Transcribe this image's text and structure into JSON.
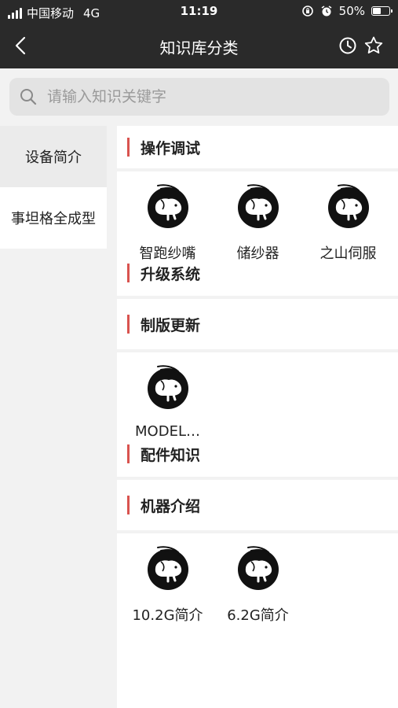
{
  "status_bar": {
    "carrier": "中国移动",
    "network": "4G",
    "time": "11:19",
    "battery_text": "50%",
    "battery_level": 0.5
  },
  "nav": {
    "title": "知识库分类"
  },
  "search": {
    "placeholder": "请输入知识关键字",
    "value": ""
  },
  "sidebar": {
    "items": [
      {
        "label": "设备简介",
        "active": true
      },
      {
        "label": "事坦格全成型",
        "active": false
      }
    ]
  },
  "sections": [
    {
      "title": "操作调试",
      "items": [
        {
          "label": "智跑纱嘴",
          "icon": "brand-logo-icon"
        },
        {
          "label": "储纱器",
          "icon": "brand-logo-icon"
        },
        {
          "label": "之山伺服",
          "icon": "brand-logo-icon"
        }
      ]
    },
    {
      "title": "升级系统",
      "items": []
    },
    {
      "title": "制版更新",
      "items": [
        {
          "label": "MODEL…",
          "icon": "brand-logo-icon"
        }
      ]
    },
    {
      "title": "配件知识",
      "items": []
    },
    {
      "title": "机器介绍",
      "items": [
        {
          "label": "10.2G简介",
          "icon": "brand-logo-icon"
        },
        {
          "label": "6.2G简介",
          "icon": "brand-logo-icon"
        }
      ]
    }
  ],
  "colors": {
    "header_bg": "#2a2a2a",
    "accent": "#d9534f"
  }
}
